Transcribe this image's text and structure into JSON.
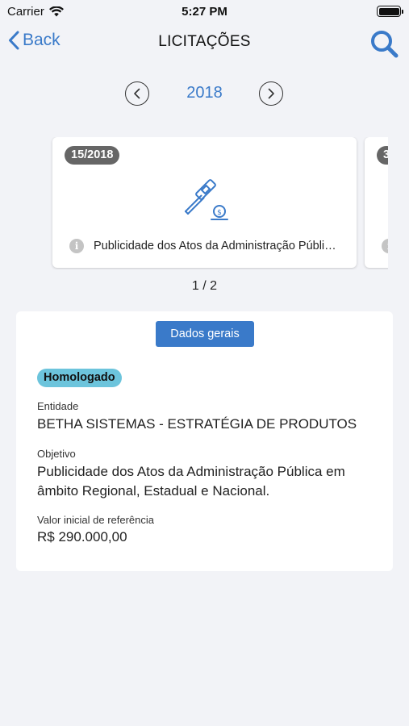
{
  "status_bar": {
    "carrier": "Carrier",
    "time": "5:27 PM"
  },
  "nav": {
    "back_label": "Back",
    "title": "LICITAÇÕES"
  },
  "year_selector": {
    "year": "2018"
  },
  "cards": [
    {
      "number": "15/2018",
      "description": "Publicidade dos Atos da Administração Públi…",
      "icon": "auction-gavel-icon"
    },
    {
      "number": "3"
    }
  ],
  "pager": "1 / 2",
  "details": {
    "tab_label": "Dados gerais",
    "status": "Homologado",
    "entity_label": "Entidade",
    "entity_value": "BETHA SISTEMAS - ESTRATÉGIA DE PRODUTOS",
    "object_label": "Objetivo",
    "object_value": "Publicidade dos Atos da Administração Pública em âmbito Regional, Estadual e Nacional.",
    "value_label": "Valor inicial de referência",
    "value_amount": "R$ 290.000,00"
  },
  "colors": {
    "accent": "#3a7ac9",
    "status_badge": "#6cc4dc",
    "number_badge": "#666666",
    "background": "#f2f3f7"
  }
}
